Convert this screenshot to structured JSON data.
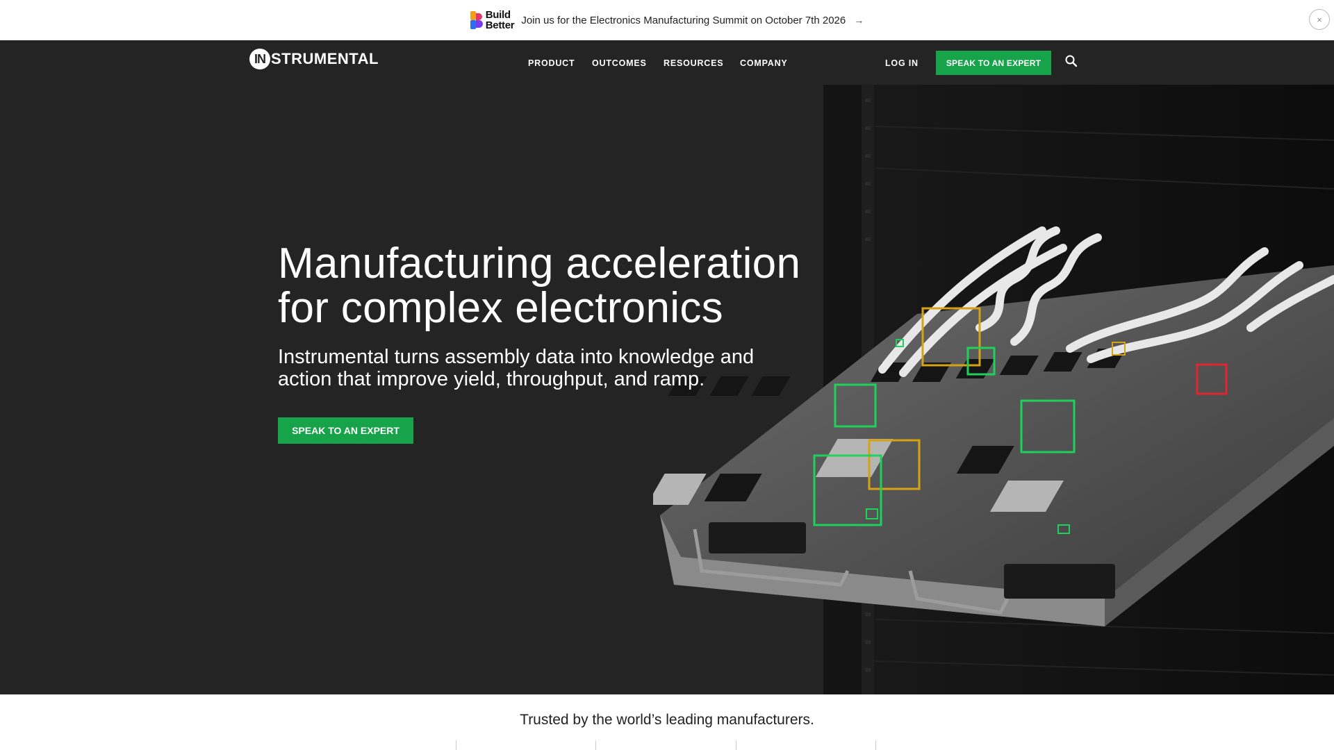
{
  "announcement": {
    "brand_line1": "Build",
    "brand_line2": "Better",
    "message": "Join us for the Electronics Manufacturing Summit on October 7th 2026",
    "arrow": "→",
    "close": "×"
  },
  "nav": {
    "logo_mark": "IN",
    "logo_text": "STRUMENTAL",
    "links": [
      "PRODUCT",
      "OUTCOMES",
      "RESOURCES",
      "COMPANY"
    ],
    "login": "LOG IN",
    "cta": "SPEAK TO AN EXPERT",
    "search_icon": "search-icon"
  },
  "hero": {
    "headline_line1": "Manufacturing acceleration",
    "headline_line2": "for complex electronics",
    "subhead_line1": "Instrumental turns assembly data into knowledge and",
    "subhead_line2": "action that improve yield, throughput, and ramp.",
    "cta": "SPEAK TO AN EXPERT"
  },
  "trusted": {
    "text": "Trusted by the world’s leading manufacturers."
  },
  "colors": {
    "accent_green": "#17a34a",
    "hero_bg": "#242424",
    "box_green": "#1ed15a",
    "box_yellow": "#d6a312",
    "box_red": "#e0262e"
  }
}
